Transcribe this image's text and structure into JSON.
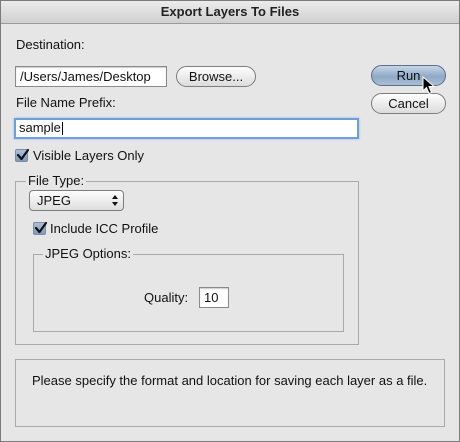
{
  "window": {
    "title": "Export Layers To Files"
  },
  "destination": {
    "label": "Destination:",
    "path": "/Users/James/Desktop",
    "browse_label": "Browse..."
  },
  "buttons": {
    "run_label": "Run",
    "cancel_label": "Cancel"
  },
  "prefix": {
    "label": "File Name Prefix:",
    "value": "sample"
  },
  "visible_layers": {
    "label": "Visible Layers Only",
    "checked": true
  },
  "file_type": {
    "legend": "File Type:",
    "selected": "JPEG",
    "icc_label": "Include ICC Profile",
    "icc_checked": true
  },
  "jpeg_options": {
    "legend": "JPEG Options:",
    "quality_label": "Quality:",
    "quality_value": "10"
  },
  "message": "Please specify the format and location for saving each layer as a file."
}
